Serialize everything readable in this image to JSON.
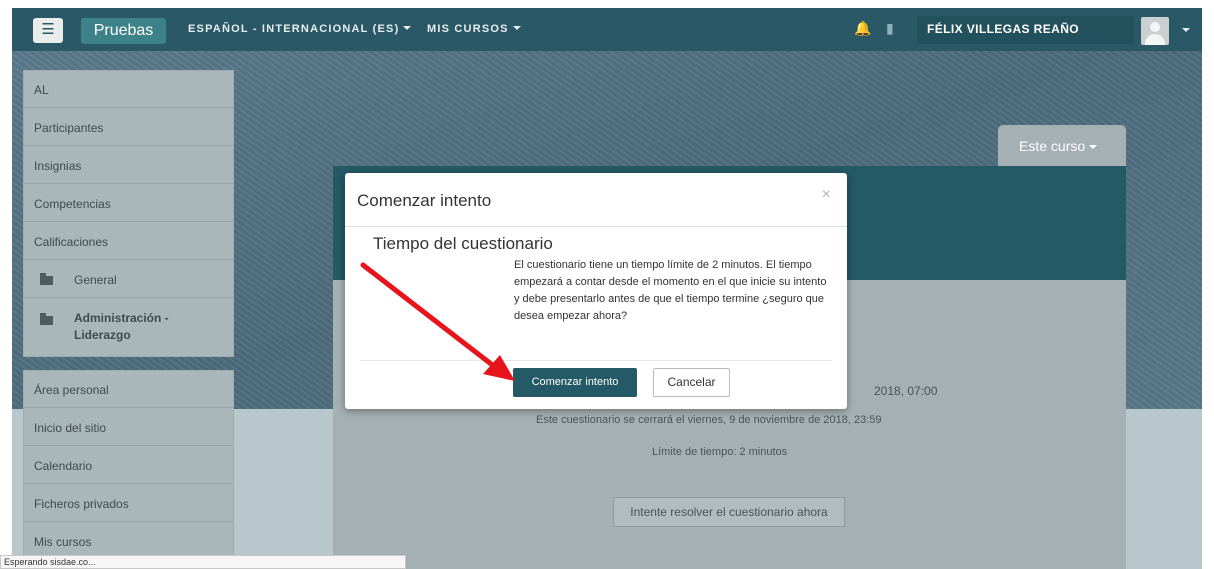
{
  "navbar": {
    "menu_icon": "hamburger-icon",
    "brand": "Pruebas",
    "language": "ESPAÑOL - INTERNACIONAL (ES)",
    "my_courses": "MIS CURSOS",
    "notification_icon": "bell-icon",
    "message_icon": "chat-icon",
    "user_name": "FÉLIX VILLEGAS REAÑO",
    "avatar_icon": "user-avatar-icon"
  },
  "sidebar": {
    "course_items": [
      {
        "label": "AL"
      },
      {
        "label": "Participantes"
      },
      {
        "label": "Insignias"
      },
      {
        "label": "Competencias"
      },
      {
        "label": "Calificaciones"
      },
      {
        "label": "General",
        "icon": "folder-icon"
      },
      {
        "label": "Administración -\nLiderazgo",
        "icon": "folder-icon"
      }
    ],
    "site_items": [
      {
        "label": "Área personal"
      },
      {
        "label": "Inicio del sitio"
      },
      {
        "label": "Calendario"
      },
      {
        "label": "Ficheros privados"
      },
      {
        "label": "Mis cursos"
      }
    ]
  },
  "course": {
    "este_curso": "Este curso",
    "open_partial": "2018, 07:00",
    "close_line": "Este cuestionario se cerrará el viernes, 9 de noviembre de 2018, 23:59",
    "time_limit": "Límite de tiempo: 2 minutos",
    "attempt_button": "Intente resolver el cuestionario ahora"
  },
  "modal": {
    "title": "Comenzar intento",
    "close": "×",
    "subtitle": "Tiempo del cuestionario",
    "lines": [
      "El cuestionario tiene un tiempo límite de 2 minutos. El tiempo",
      "empezará a contar desde el momento en el que inicie su intento",
      "y debe presentarlo antes de que el tiempo termine ¿seguro que",
      "desea empezar ahora?"
    ],
    "start_button": "Comenzar intento",
    "cancel_button": "Cancelar"
  },
  "status_bar": {
    "text": "Esperando sisdae.co..."
  },
  "colors": {
    "navbar": "#2a5866",
    "brand": "#3e8289",
    "primary_button": "#245966",
    "arrow": "#e8141b"
  }
}
